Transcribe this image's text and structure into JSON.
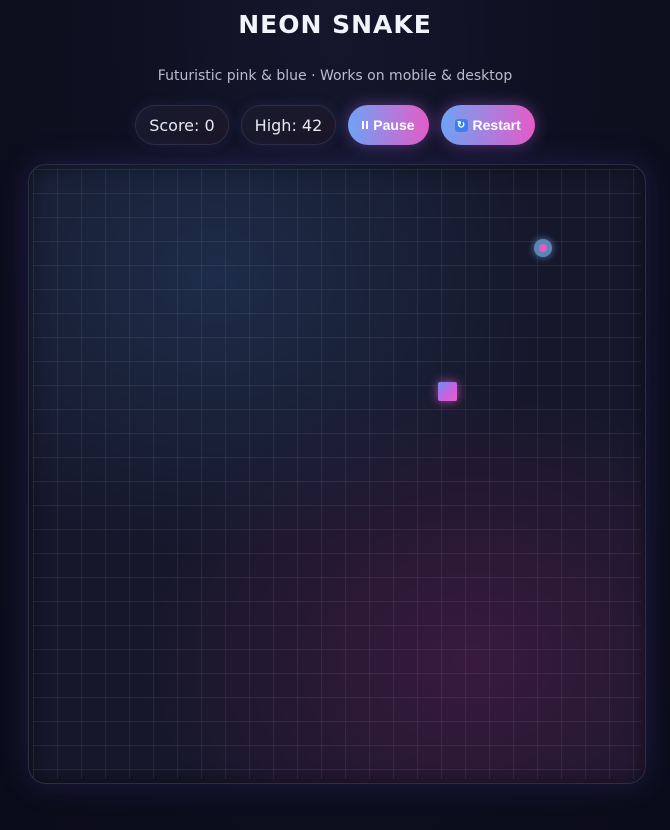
{
  "header": {
    "title": "NEON SNAKE",
    "subtitle": "Futuristic pink & blue · Works on mobile & desktop"
  },
  "hud": {
    "score_label": "Score: 0",
    "score": 0,
    "high_label": "High: 42",
    "high_score": 42,
    "pause_label": "Pause",
    "pause_icon": "pause-icon",
    "restart_label": "Restart",
    "restart_icon": "restart-icon"
  },
  "game": {
    "state": "running",
    "food_color": "#e35bc6",
    "food_ring_color": "#5a86b5",
    "snake_colors": [
      "#6b8ff0",
      "#e85ccb"
    ]
  },
  "theme": {
    "accent_blue": "#6ea3f4",
    "accent_pink": "#e45cc8",
    "background": "#0d0e1e"
  }
}
